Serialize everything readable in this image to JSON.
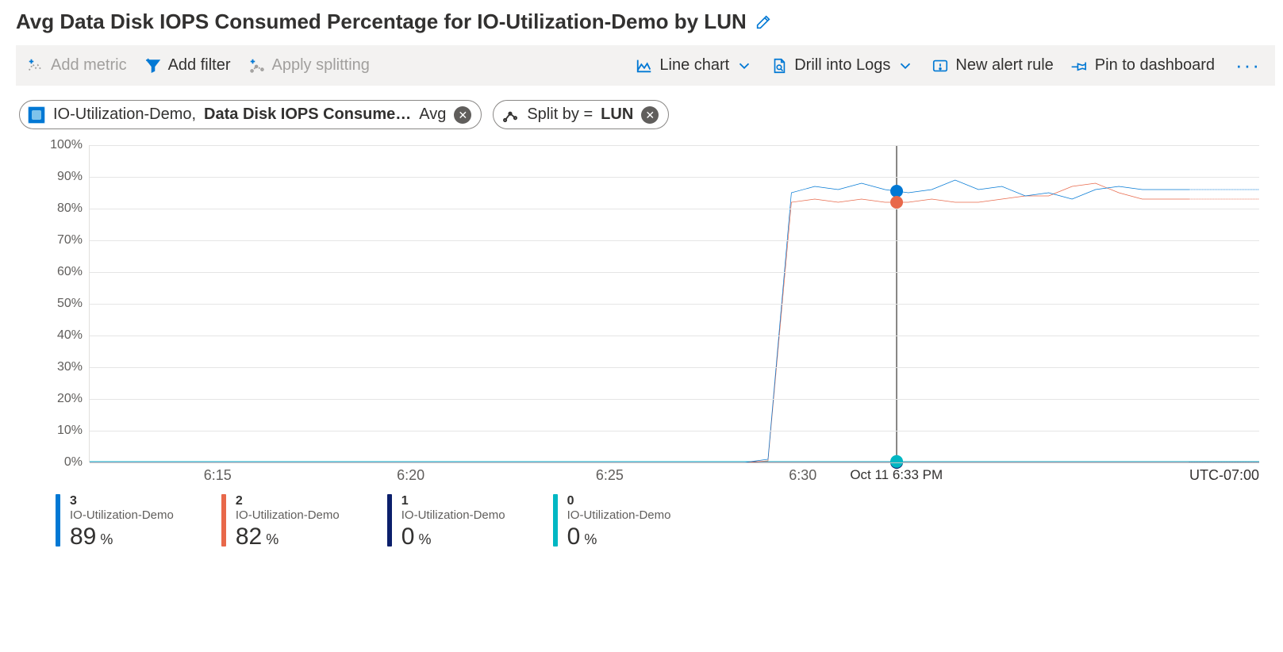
{
  "title": "Avg Data Disk IOPS Consumed Percentage for IO-Utilization-Demo by LUN",
  "toolbar": {
    "add_metric": "Add metric",
    "add_filter": "Add filter",
    "apply_splitting": "Apply splitting",
    "line_chart": "Line chart",
    "drill_logs": "Drill into Logs",
    "new_alert": "New alert rule",
    "pin_dash": "Pin to dashboard"
  },
  "pills": {
    "metric": {
      "resource": "IO-Utilization-Demo,",
      "name": "Data Disk IOPS Consume…",
      "agg": "Avg"
    },
    "split": {
      "prefix": "Split by =",
      "value": "LUN"
    }
  },
  "timezone": "UTC-07:00",
  "hover_label": "Oct 11 6:33 PM",
  "chart_data": {
    "type": "line",
    "xlabel": "",
    "ylabel": "",
    "ylim": [
      0,
      100
    ],
    "y_ticks": [
      "0%",
      "10%",
      "20%",
      "30%",
      "40%",
      "50%",
      "60%",
      "70%",
      "80%",
      "90%",
      "100%"
    ],
    "x_ticks": [
      {
        "label": "6:15",
        "pos": 11.0
      },
      {
        "label": "6:20",
        "pos": 27.5
      },
      {
        "label": "6:25",
        "pos": 44.5
      },
      {
        "label": "6:30",
        "pos": 61.0
      }
    ],
    "hover_x": 69.0,
    "series": [
      {
        "name": "3",
        "resource": "IO-Utilization-Demo",
        "color": "#0078d4",
        "hover_value": 89,
        "x": [
          0,
          56,
          58,
          60,
          62,
          64,
          66,
          68,
          70,
          72,
          74,
          76,
          78,
          80,
          82,
          84,
          86,
          88,
          90,
          92,
          94
        ],
        "y": [
          0,
          0,
          1,
          85,
          87,
          86,
          88,
          86,
          85,
          86,
          89,
          86,
          87,
          84,
          85,
          83,
          86,
          87,
          86,
          86,
          86
        ],
        "dash_x": [
          94,
          100
        ],
        "dash_y": [
          86,
          86
        ]
      },
      {
        "name": "2",
        "resource": "IO-Utilization-Demo",
        "color": "#e8684a",
        "hover_value": 82,
        "x": [
          0,
          56,
          58,
          60,
          62,
          64,
          66,
          68,
          70,
          72,
          74,
          76,
          78,
          80,
          82,
          84,
          86,
          88,
          90,
          92,
          94
        ],
        "y": [
          0,
          0,
          0.5,
          82,
          83,
          82,
          83,
          82,
          82,
          83,
          82,
          82,
          83,
          84,
          84,
          87,
          88,
          85,
          83,
          83,
          83
        ],
        "dash_x": [
          94,
          100
        ],
        "dash_y": [
          83,
          83
        ]
      },
      {
        "name": "1",
        "resource": "IO-Utilization-Demo",
        "color": "#0b1f6b",
        "hover_value": 0,
        "x": [
          0,
          100
        ],
        "y": [
          0,
          0
        ],
        "dash_x": [
          94,
          100
        ],
        "dash_y": [
          0,
          0
        ]
      },
      {
        "name": "0",
        "resource": "IO-Utilization-Demo",
        "color": "#00b7c3",
        "hover_value": 0,
        "x": [
          0,
          100
        ],
        "y": [
          0.3,
          0.3
        ],
        "dash_x": [
          94,
          100
        ],
        "dash_y": [
          0.3,
          0.3
        ]
      }
    ]
  }
}
